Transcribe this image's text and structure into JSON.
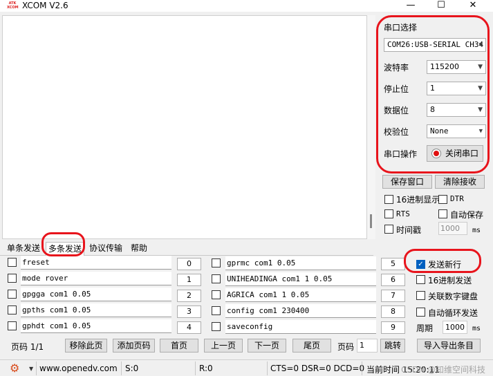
{
  "window": {
    "title": "XCOM V2.6",
    "logo_text": "ATK XCOM",
    "minimize": "—",
    "maximize": "☐",
    "close": "✕"
  },
  "serial": {
    "section_title": "串口选择",
    "port": "COM26:USB-SERIAL CH34",
    "baud_label": "波特率",
    "baud": "115200",
    "stop_label": "停止位",
    "stop": "1",
    "data_label": "数据位",
    "data": "8",
    "parity_label": "校验位",
    "parity": "None",
    "op_label": "串口操作",
    "op_button": "关闭串口"
  },
  "actions": {
    "save_window": "保存窗口",
    "clear_recv": "清除接收"
  },
  "options": {
    "hex_display": "16进制显示",
    "dtr": "DTR",
    "rts": "RTS",
    "auto_save": "自动保存",
    "timestamp": "时间戳",
    "timestamp_value": "1000",
    "timestamp_unit": "ms"
  },
  "tabs": [
    "单条发送",
    "多条发送",
    "协议传输",
    "帮助"
  ],
  "commands": [
    {
      "text": "freset",
      "num": "0"
    },
    {
      "text": "mode rover",
      "num": "1"
    },
    {
      "text": "gpgga com1 0.05",
      "num": "2"
    },
    {
      "text": "gpths com1 0.05",
      "num": "3"
    },
    {
      "text": "gphdt com1 0.05",
      "num": "4"
    },
    {
      "text": "gprmc com1 0.05",
      "num": "5"
    },
    {
      "text": "UNIHEADINGA com1 1 0.05",
      "num": "6"
    },
    {
      "text": "AGRICA com1 1 0.05",
      "num": "7"
    },
    {
      "text": "config com1 230400",
      "num": "8"
    },
    {
      "text": "saveconfig",
      "num": "9"
    }
  ],
  "send_options": {
    "send_newline": "发送新行",
    "hex_send": "16进制发送",
    "link_keypad": "关联数字键盘",
    "auto_cycle": "自动循环发送",
    "period_label": "周期",
    "period_value": "1000",
    "period_unit": "ms"
  },
  "pager": {
    "page_info": "页码 1/1",
    "remove_page": "移除此页",
    "add_page": "添加页码",
    "first": "首页",
    "prev": "上一页",
    "next": "下一页",
    "last": "尾页",
    "page_label": "页码",
    "page_value": "1",
    "jump": "跳转",
    "import_export": "导入导出条目"
  },
  "status": {
    "url": "www.openedv.com",
    "sent": "S:0",
    "recv": "R:0",
    "lines": "CTS=0 DSR=0 DCD=0",
    "time": "当前时间 15:20:11",
    "watermark": "CSDN @知维空间科技"
  },
  "colors": {
    "annotation": "#e8141c",
    "checkbox_on": "#0060c0"
  }
}
